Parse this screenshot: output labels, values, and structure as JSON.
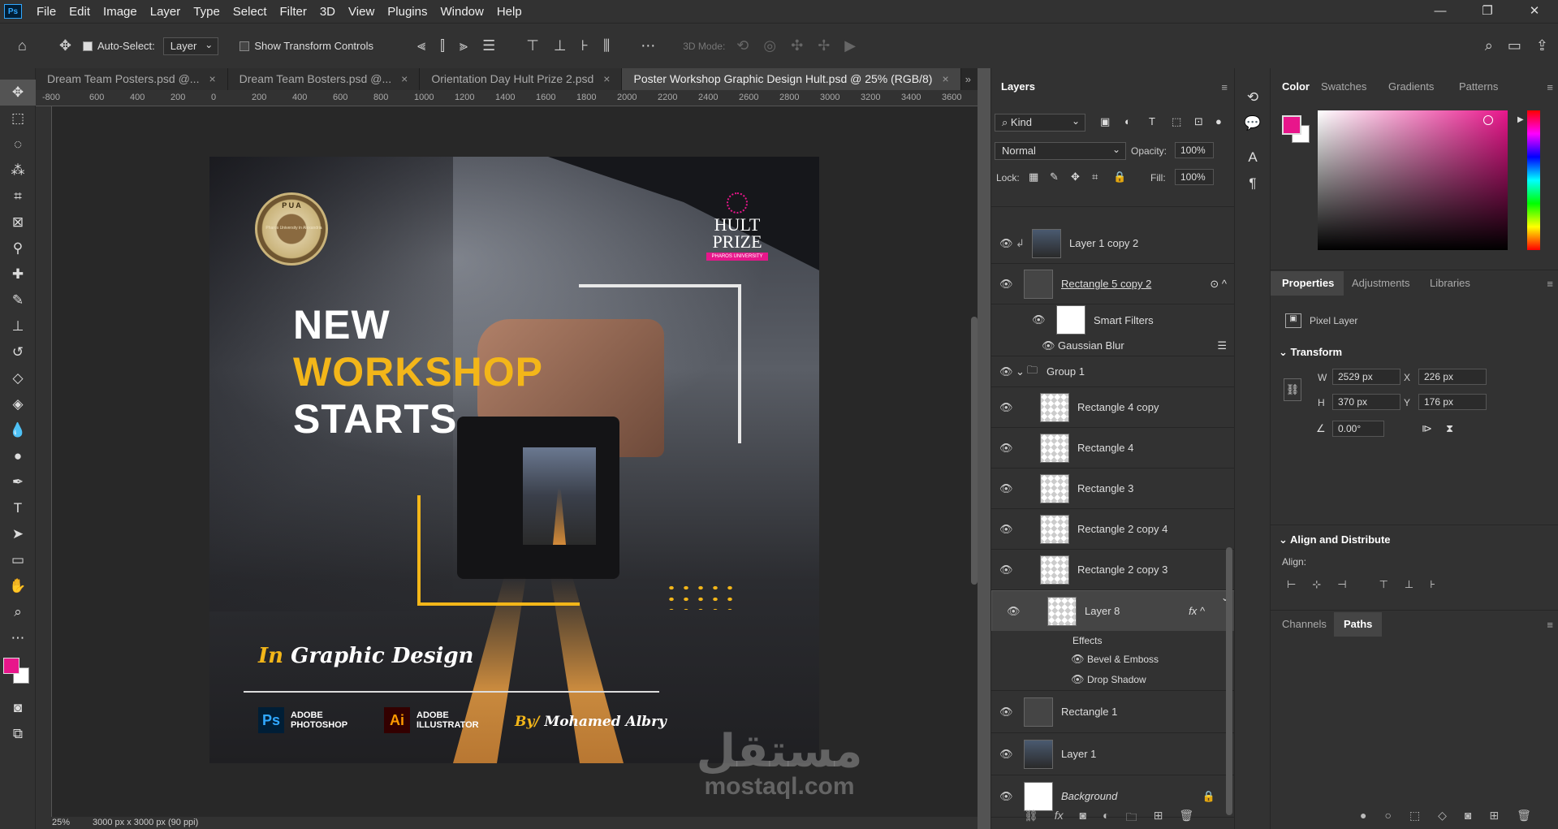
{
  "menu": [
    "File",
    "Edit",
    "Image",
    "Layer",
    "Type",
    "Select",
    "Filter",
    "3D",
    "View",
    "Plugins",
    "Window",
    "Help"
  ],
  "app_logo": "Ps",
  "window_controls": [
    "—",
    "❐",
    "✕"
  ],
  "options": {
    "auto_select_label": "Auto-Select:",
    "auto_select_value": "Layer",
    "transform_label": "Show Transform Controls",
    "mode_label": "3D Mode:"
  },
  "tabs": [
    {
      "label": "Dream Team Posters.psd @..."
    },
    {
      "label": "Dream Team Bosters.psd @..."
    },
    {
      "label": "Orientation Day Hult Prize 2.psd"
    },
    {
      "label": "Poster Workshop Graphic Design Hult.psd @ 25% (RGB/8)"
    }
  ],
  "ruler_ticks": [
    "-800",
    "600",
    "400",
    "200",
    "0",
    "200",
    "400",
    "600",
    "800",
    "1000",
    "1200",
    "1400",
    "1600",
    "1800",
    "2000",
    "2200",
    "2400",
    "2600",
    "2800",
    "3000",
    "3200",
    "3400",
    "3600"
  ],
  "status": {
    "zoom": "25%",
    "doc_size": "3000 px x 3000 px (90 ppi)"
  },
  "poster": {
    "line1": "NEW",
    "line2": "WORKSHOP",
    "line3": "STARTS",
    "subtitle_in": "In",
    "subtitle_rest": "Graphic Design",
    "ps_badge": "Ps",
    "ps_label1": "ADOBE",
    "ps_label2": "PHOTOSHOP",
    "ai_badge": "Ai",
    "ai_label1": "ADOBE",
    "ai_label2": "ILLUSTRATOR",
    "by": "By/",
    "author": "Mohamed Albry",
    "hult1": "HULT",
    "hult2": "PRIZE",
    "hult3": "PHAROS UNIVERSITY",
    "seal": "P U A",
    "seal_sub": "Pharos University in Alexandria"
  },
  "watermark": {
    "arabic": "مستقل",
    "latin": "mostaql.com"
  },
  "layers_panel": {
    "title": "Layers",
    "filter": "Kind",
    "blend": "Normal",
    "opacity_label": "Opacity:",
    "opacity": "100%",
    "lock_label": "Lock:",
    "fill_label": "Fill:",
    "fill": "100%",
    "rows": [
      {
        "name": "Layer 1 copy 2",
        "kind": "photo"
      },
      {
        "name": "Rectangle 5 copy 2",
        "kind": "dark"
      },
      {
        "name": "Smart Filters",
        "kind": "white"
      },
      {
        "name": "Gaussian Blur",
        "kind": "none"
      },
      {
        "name": "Group 1",
        "kind": "group"
      },
      {
        "name": "Rectangle 4 copy",
        "kind": "trans"
      },
      {
        "name": "Rectangle 4",
        "kind": "trans"
      },
      {
        "name": "Rectangle 3",
        "kind": "trans"
      },
      {
        "name": "Rectangle 2 copy 4",
        "kind": "trans"
      },
      {
        "name": "Rectangle 2 copy 3",
        "kind": "trans"
      },
      {
        "name": "Layer 8",
        "kind": "trans"
      },
      {
        "name": "Effects",
        "kind": "none"
      },
      {
        "name": "Bevel & Emboss",
        "kind": "none"
      },
      {
        "name": "Drop Shadow",
        "kind": "none"
      },
      {
        "name": "Rectangle 1",
        "kind": "dark"
      },
      {
        "name": "Layer 1",
        "kind": "photo"
      },
      {
        "name": "Background",
        "kind": "white"
      }
    ]
  },
  "color_panel": {
    "tabs": [
      "Color",
      "Swatches",
      "Gradients",
      "Patterns"
    ],
    "fg": "#e8168b",
    "bg": "#ffffff"
  },
  "properties": {
    "tabs": [
      "Properties",
      "Adjustments",
      "Libraries"
    ],
    "kind": "Pixel Layer",
    "transform": "Transform",
    "w_label": "W",
    "w": "2529 px",
    "h_label": "H",
    "h": "370 px",
    "x_label": "X",
    "x": "226 px",
    "y_label": "Y",
    "y": "176 px",
    "angle": "0.00°",
    "align": "Align and Distribute",
    "align_label": "Align:"
  },
  "bottom_panel": {
    "tabs": [
      "Channels",
      "Paths"
    ]
  }
}
